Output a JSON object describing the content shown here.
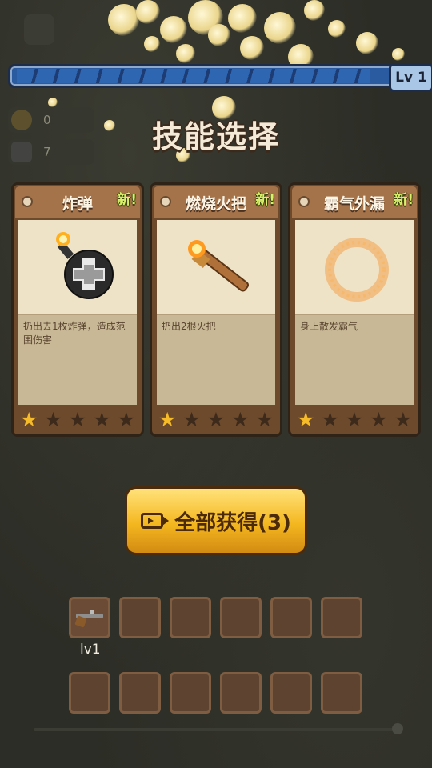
{
  "hud": {
    "pause_icon": "pause-icon",
    "level_label": "Lv 1",
    "xp_progress": 0.86,
    "coins": "0",
    "kills": "7"
  },
  "title": "技能选择",
  "cards": [
    {
      "name": "炸弹",
      "badge": "新!",
      "description": "扔出去1枚炸弹，造成范围伤害",
      "icon": "bomb-icon",
      "stars_filled": 1,
      "stars_total": 5
    },
    {
      "name": "燃烧火把",
      "badge": "新!",
      "description": "扔出2根火把",
      "icon": "torch-icon",
      "stars_filled": 1,
      "stars_total": 5
    },
    {
      "name": "霸气外漏",
      "badge": "新!",
      "description": "身上散发霸气",
      "icon": "aura-ring-icon",
      "stars_filled": 1,
      "stars_total": 5
    }
  ],
  "get_all_button": {
    "label": "全部获得(3)",
    "icon": "video-ad-icon"
  },
  "weapon_slots": {
    "first_weapon_icon": "rifle-icon",
    "first_weapon_level": "lv1"
  },
  "colors": {
    "accent": "#f4b71f",
    "card": "#a5734a",
    "xp_bar": "#2a5aa0",
    "new_badge": "#d8f06a"
  }
}
